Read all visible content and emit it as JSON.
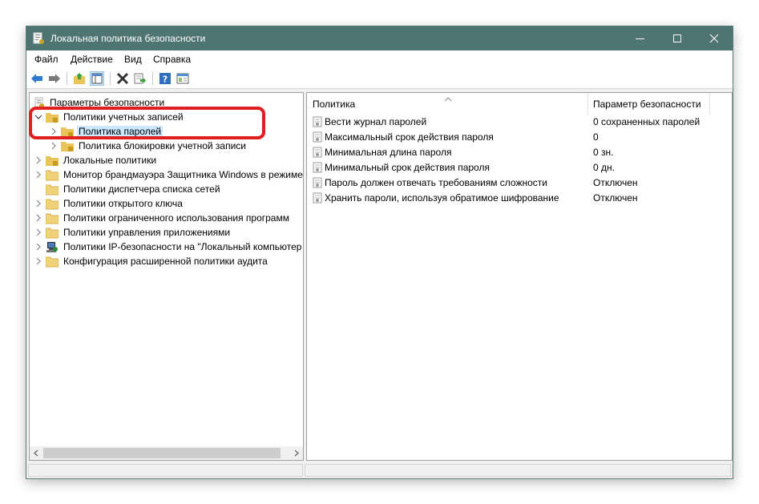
{
  "window": {
    "title": "Локальная политика безопасности",
    "title_icon": "security-policy-icon"
  },
  "window_controls": {
    "minimize": "minimize-icon",
    "maximize": "maximize-icon",
    "close": "close-icon"
  },
  "menu": [
    {
      "label": "Файл"
    },
    {
      "label": "Действие"
    },
    {
      "label": "Вид"
    },
    {
      "label": "Справка"
    }
  ],
  "toolbar": {
    "buttons": [
      "back-icon",
      "forward-icon",
      "up-folder-icon",
      "show-tree-icon",
      "delete-icon",
      "export-icon",
      "help-icon",
      "properties-icon"
    ]
  },
  "tree": {
    "root": "Параметры безопасности",
    "items": [
      {
        "label": "Политики учетных записей",
        "expanded": true
      },
      {
        "label": "Политика паролей",
        "selected": true
      },
      {
        "label": "Политика блокировки учетной записи"
      },
      {
        "label": "Локальные политики"
      },
      {
        "label": "Монитор брандмауэра Защитника Windows в режиме"
      },
      {
        "label": "Политики диспетчера списка сетей"
      },
      {
        "label": "Политики открытого ключа"
      },
      {
        "label": "Политики ограниченного использования программ"
      },
      {
        "label": "Политики управления приложениями"
      },
      {
        "label": "Политики IP-безопасности на \"Локальный компьютер"
      },
      {
        "label": "Конфигурация расширенной политики аудита"
      }
    ]
  },
  "list": {
    "columns": {
      "policy": "Политика",
      "setting": "Параметр безопасности"
    },
    "rows": [
      {
        "policy": "Вести журнал паролей",
        "setting": "0 сохраненных паролей"
      },
      {
        "policy": "Максимальный срок действия пароля",
        "setting": "0"
      },
      {
        "policy": "Минимальная длина пароля",
        "setting": "0 зн."
      },
      {
        "policy": "Минимальный срок действия пароля",
        "setting": "0 дн."
      },
      {
        "policy": "Пароль должен отвечать требованиям сложности",
        "setting": "Отключен"
      },
      {
        "policy": "Хранить пароли, используя обратимое шифрование",
        "setting": "Отключен"
      }
    ]
  },
  "colors": {
    "titlebar": "#4f7572",
    "selection": "#cce8ff",
    "highlight_frame": "#e02020"
  }
}
